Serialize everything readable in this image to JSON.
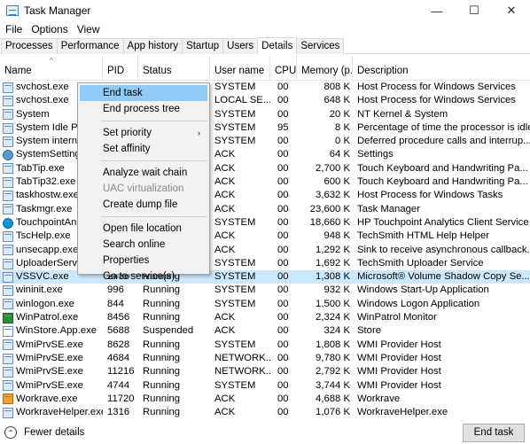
{
  "window": {
    "title": "Task Manager",
    "minimize": "—",
    "maximize": "☐",
    "close": "✕"
  },
  "menu": [
    "File",
    "Options",
    "View"
  ],
  "tabs": [
    "Processes",
    "Performance",
    "App history",
    "Startup",
    "Users",
    "Details",
    "Services"
  ],
  "active_tab": "Details",
  "columns": {
    "name": "Name",
    "pid": "PID",
    "status": "Status",
    "user": "User name",
    "cpu": "CPU",
    "memory": "Memory (p...",
    "description": "Description",
    "sort_arrow": "^"
  },
  "rows": [
    {
      "name": "svchost.exe",
      "pid": "",
      "status": "",
      "user": "SYSTEM",
      "cpu": "00",
      "memory": "808 K",
      "description": "Host Process for Windows Services",
      "icon": "window-icon"
    },
    {
      "name": "svchost.exe",
      "pid": "",
      "status": "",
      "user": "LOCAL SE...",
      "cpu": "00",
      "memory": "648 K",
      "description": "Host Process for Windows Services",
      "icon": "window-icon"
    },
    {
      "name": "System",
      "pid": "",
      "status": "",
      "user": "SYSTEM",
      "cpu": "00",
      "memory": "20 K",
      "description": "NT Kernel & System",
      "icon": "window-icon"
    },
    {
      "name": "System Idle Proc",
      "pid": "",
      "status": "",
      "user": "SYSTEM",
      "cpu": "95",
      "memory": "8 K",
      "description": "Percentage of time the processor is idle",
      "icon": "window-icon"
    },
    {
      "name": "System interrupt",
      "pid": "",
      "status": "",
      "user": "SYSTEM",
      "cpu": "00",
      "memory": "0 K",
      "description": "Deferred procedure calls and interrup...",
      "icon": "window-icon"
    },
    {
      "name": "SystemSettings.",
      "pid": "",
      "status": "",
      "user": "ACK",
      "cpu": "00",
      "memory": "64 K",
      "description": "Settings",
      "icon": "gear-icon"
    },
    {
      "name": "TabTip.exe",
      "pid": "",
      "status": "",
      "user": "ACK",
      "cpu": "00",
      "memory": "2,700 K",
      "description": "Touch Keyboard and Handwriting Pa...",
      "icon": "window-icon"
    },
    {
      "name": "TabTip32.exe",
      "pid": "",
      "status": "",
      "user": "ACK",
      "cpu": "00",
      "memory": "600 K",
      "description": "Touch Keyboard and Handwriting Pa...",
      "icon": "window-icon"
    },
    {
      "name": "taskhostw.exe",
      "pid": "",
      "status": "",
      "user": "ACK",
      "cpu": "00",
      "memory": "3,632 K",
      "description": "Host Process for Windows Tasks",
      "icon": "window-icon"
    },
    {
      "name": "Taskmgr.exe",
      "pid": "",
      "status": "",
      "user": "ACK",
      "cpu": "00",
      "memory": "23,600 K",
      "description": "Task Manager",
      "icon": "window-icon"
    },
    {
      "name": "TouchpointAnal",
      "pid": "",
      "status": "",
      "user": "SYSTEM",
      "cpu": "00",
      "memory": "18,660 K",
      "description": "HP Touchpoint Analytics Client Service",
      "icon": "hp-icon"
    },
    {
      "name": "TscHelp.exe",
      "pid": "",
      "status": "",
      "user": "ACK",
      "cpu": "00",
      "memory": "948 K",
      "description": "TechSmith HTML Help Helper",
      "icon": "window-icon"
    },
    {
      "name": "unsecapp.exe",
      "pid": "",
      "status": "",
      "user": "ACK",
      "cpu": "00",
      "memory": "1,292 K",
      "description": "Sink to receive asynchronous callback...",
      "icon": "window-icon"
    },
    {
      "name": "UploaderService",
      "pid": "",
      "status": "",
      "user": "SYSTEM",
      "cpu": "00",
      "memory": "1,692 K",
      "description": "TechSmith Uploader Service",
      "icon": "window-icon"
    },
    {
      "name": "VSSVC.exe",
      "pid": "2436",
      "status": "Running",
      "user": "SYSTEM",
      "cpu": "00",
      "memory": "1,308 K",
      "description": "Microsoft® Volume Shadow Copy Se...",
      "icon": "window-icon",
      "selected": true
    },
    {
      "name": "wininit.exe",
      "pid": "996",
      "status": "Running",
      "user": "SYSTEM",
      "cpu": "00",
      "memory": "932 K",
      "description": "Windows Start-Up Application",
      "icon": "window-icon"
    },
    {
      "name": "winlogon.exe",
      "pid": "844",
      "status": "Running",
      "user": "SYSTEM",
      "cpu": "00",
      "memory": "1,500 K",
      "description": "Windows Logon Application",
      "icon": "window-icon"
    },
    {
      "name": "WinPatrol.exe",
      "pid": "8456",
      "status": "Running",
      "user": "ACK",
      "cpu": "00",
      "memory": "2,324 K",
      "description": "WinPatrol Monitor",
      "icon": "winpatrol-icon"
    },
    {
      "name": "WinStore.App.exe",
      "pid": "5688",
      "status": "Suspended",
      "user": "ACK",
      "cpu": "00",
      "memory": "324 K",
      "description": "Store",
      "icon": "store-icon"
    },
    {
      "name": "WmiPrvSE.exe",
      "pid": "8628",
      "status": "Running",
      "user": "SYSTEM",
      "cpu": "00",
      "memory": "1,808 K",
      "description": "WMI Provider Host",
      "icon": "window-icon"
    },
    {
      "name": "WmiPrvSE.exe",
      "pid": "4684",
      "status": "Running",
      "user": "NETWORK...",
      "cpu": "00",
      "memory": "9,780 K",
      "description": "WMI Provider Host",
      "icon": "window-icon"
    },
    {
      "name": "WmiPrvSE.exe",
      "pid": "11216",
      "status": "Running",
      "user": "NETWORK...",
      "cpu": "00",
      "memory": "2,792 K",
      "description": "WMI Provider Host",
      "icon": "window-icon"
    },
    {
      "name": "WmiPrvSE.exe",
      "pid": "4744",
      "status": "Running",
      "user": "SYSTEM",
      "cpu": "00",
      "memory": "3,744 K",
      "description": "WMI Provider Host",
      "icon": "window-icon"
    },
    {
      "name": "Workrave.exe",
      "pid": "11720",
      "status": "Running",
      "user": "ACK",
      "cpu": "00",
      "memory": "4,688 K",
      "description": "Workrave",
      "icon": "workrave-icon"
    },
    {
      "name": "WorkraveHelper.exe",
      "pid": "1316",
      "status": "Running",
      "user": "ACK",
      "cpu": "00",
      "memory": "1,076 K",
      "description": "WorkraveHelper.exe",
      "icon": "window-icon"
    }
  ],
  "context_menu": {
    "groups": [
      [
        {
          "label": "End task",
          "highlight": true
        },
        {
          "label": "End process tree"
        }
      ],
      [
        {
          "label": "Set priority",
          "submenu": true
        },
        {
          "label": "Set affinity"
        }
      ],
      [
        {
          "label": "Analyze wait chain"
        },
        {
          "label": "UAC virtualization",
          "disabled": true
        },
        {
          "label": "Create dump file"
        }
      ],
      [
        {
          "label": "Open file location"
        },
        {
          "label": "Search online"
        },
        {
          "label": "Properties"
        },
        {
          "label": "Go to service(s)"
        }
      ]
    ],
    "submenu_arrow": "›"
  },
  "footer": {
    "fewer_details": "Fewer details",
    "chevron": "⌃",
    "end_task": "End task"
  }
}
